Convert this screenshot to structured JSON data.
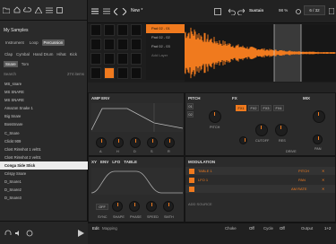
{
  "browser": {
    "title": "My Samples",
    "tabs_primary": [
      "Instrument",
      "Loop",
      "Percussion"
    ],
    "tabs_secondary": [
      "Clap",
      "Cymbal",
      "Hand Drum",
      "Hihat",
      "Kick"
    ],
    "tabs_tertiary": [
      "Snare",
      "Tom"
    ],
    "search_placeholder": "Search",
    "search_count": "274 items",
    "items": [
      "MS_snare",
      "MS SNARE",
      "MS SNARE",
      "Amazon Snake 1",
      "Big Snare",
      "BossSnare",
      "C_Snare",
      "Clickt 909",
      "Clost Rimshot 1 vel01",
      "Clost Rimshot 2 vel01",
      "Conga Side Stick",
      "Crispy Snare",
      "D_Snare1",
      "D_Snare2",
      "D_Snare3"
    ],
    "selected_index": 10
  },
  "toolbar": {
    "project_title": "New *",
    "mode": "Sustain",
    "zoom": "98 %",
    "page": "6 / 32"
  },
  "pads": {
    "list": [
      "Pad 02 - 01",
      "Pad 02 - 02",
      "Pad 02 - 03",
      "Add Layer"
    ],
    "selected": 0,
    "bank_label": "01"
  },
  "sections": {
    "amp_env": "AMP ENV",
    "pitch": "PITCH",
    "fx": "FX",
    "mix": "MIX",
    "fx_tabs": [
      "FX1",
      "FX2",
      "FX3",
      "FX4"
    ],
    "fx_knobs": [
      "PITCH",
      "CUTOFF",
      "RES",
      "DRIVE",
      "PAN"
    ],
    "amp_knobs": [
      "A",
      "H",
      "D",
      "S",
      "R"
    ],
    "mod_tabs": [
      "XY",
      "ENV",
      "LFO",
      "TABLE"
    ],
    "lfo_labels": [
      "SYNC",
      "SHAPE",
      "PHASE",
      "SPEED",
      "SMTH"
    ],
    "lfo_button": "OFF",
    "modulation": "MODULATION",
    "mod_rows": [
      {
        "source": "TABLE 1",
        "target": "PITCH"
      },
      {
        "source": "LFO 1",
        "target": "PAN"
      },
      {
        "source": "",
        "target": "AM RATE"
      }
    ],
    "add_source": "ADD SOURCE"
  },
  "status": {
    "edit": "Edit",
    "mapping": "Mapping",
    "note": "Choke",
    "off1": "Off",
    "cycle": "Cycle",
    "off2": "Off",
    "output": "Output",
    "out_val": "1+2"
  },
  "colors": {
    "accent": "#f07a1e",
    "panel": "#2b2b2b",
    "background": "#1d1d1d"
  }
}
